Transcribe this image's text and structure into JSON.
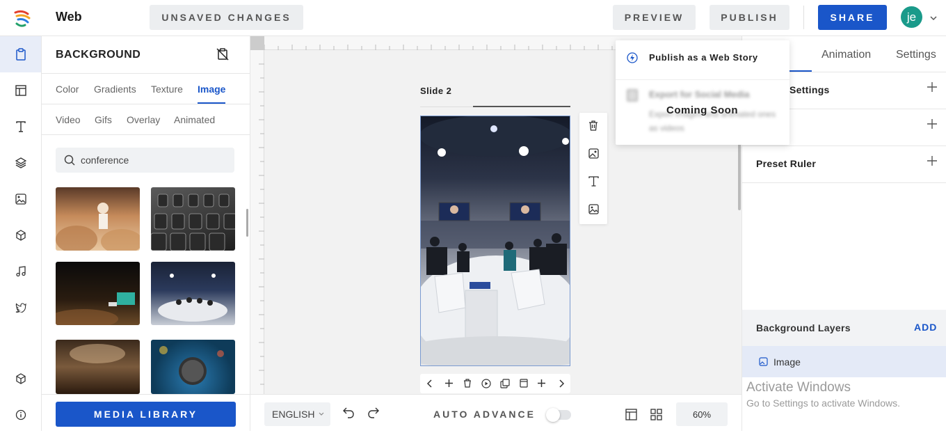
{
  "app": {
    "title": "Web",
    "status": "UNSAVED CHANGES"
  },
  "header": {
    "preview_label": "PREVIEW",
    "publish_label": "PUBLISH",
    "share_label": "SHARE",
    "avatar_initials": "je"
  },
  "rail": {
    "items": [
      "clipboard-icon",
      "layout-icon",
      "text-icon",
      "layers-icon",
      "image-icon",
      "cube-icon",
      "music-icon",
      "twitter-icon",
      "package-icon",
      "info-icon"
    ]
  },
  "left_panel": {
    "title": "BACKGROUND",
    "tabs_row1": [
      "Color",
      "Gradients",
      "Texture",
      "Image"
    ],
    "tabs_row2": [
      "Video",
      "Gifs",
      "Overlay",
      "Animated"
    ],
    "active_tab": "Image",
    "search": {
      "value": "conference",
      "placeholder": ""
    },
    "media_library_label": "MEDIA LIBRARY"
  },
  "canvas": {
    "slide_label": "Slide 2"
  },
  "bottom_bar": {
    "language": "ENGLISH",
    "auto_advance_label": "AUTO ADVANCE",
    "zoom": "60%"
  },
  "right_panel": {
    "tabs": [
      "n",
      "Animation",
      "Settings"
    ],
    "rows": [
      "Settings",
      "",
      "Preset Ruler"
    ],
    "background_layers_label": "Background Layers",
    "add_label": "ADD",
    "layer_item": "Image"
  },
  "publish_popup": {
    "web_story_label": "Publish as a Web Story",
    "social_title": "Export for Social Media",
    "social_desc": "Export images and animated ones as videos",
    "coming_soon": "Coming Soon"
  },
  "watermark": {
    "line1": "Activate Windows",
    "line2": "Go to Settings to activate Windows."
  },
  "colors": {
    "accent": "#1a56c9",
    "avatar": "#1a9a8a"
  }
}
